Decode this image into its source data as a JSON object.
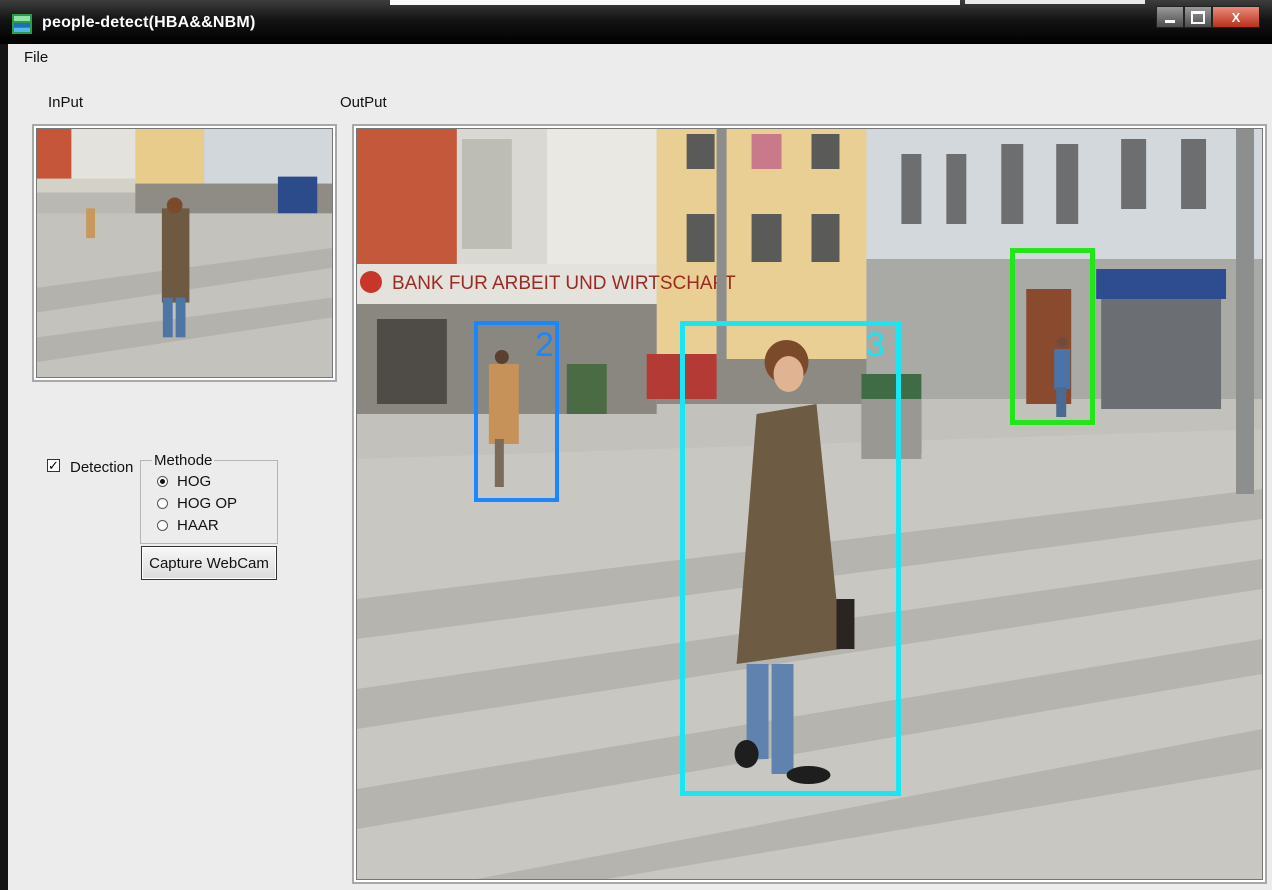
{
  "window": {
    "title": "people-detect(HBA&&NBM)",
    "buttons": {
      "minimize": "–",
      "maximize": "□",
      "close": "X"
    }
  },
  "menu": {
    "file": "File"
  },
  "input_panel": {
    "label": "InPut"
  },
  "output_panel": {
    "label": "OutPut"
  },
  "scene": {
    "bank_sign": "BANK FUR ARBEIT UND WIRTSCHAFT"
  },
  "detection": {
    "label": "Detection",
    "checked": true
  },
  "methode": {
    "legend": "Methode",
    "options": [
      "HOG",
      "HOG OP",
      "HAAR"
    ],
    "selected": "HOG"
  },
  "capture_button": "Capture WebCam",
  "detections": [
    {
      "id": "2",
      "color": "#1a86ff"
    },
    {
      "id": "3",
      "color": "#19e6f2"
    },
    {
      "id": "",
      "color": "#22e51a"
    }
  ],
  "colors": {
    "titlebar": "#111111",
    "client": "#ececec"
  }
}
